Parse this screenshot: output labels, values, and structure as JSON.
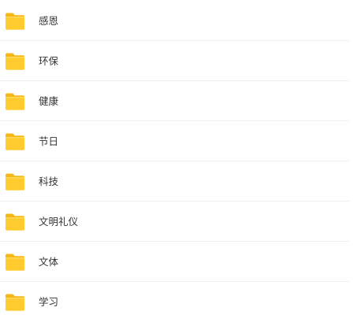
{
  "colors": {
    "folder_tab": "#F6B817",
    "folder_body": "#FFCB2F",
    "folder_highlight": "#FFD95A",
    "text": "#333333",
    "divider": "#F1F1F1"
  },
  "folders": [
    {
      "label": "感恩",
      "icon": "folder-icon"
    },
    {
      "label": "环保",
      "icon": "folder-icon"
    },
    {
      "label": "健康",
      "icon": "folder-icon"
    },
    {
      "label": "节日",
      "icon": "folder-icon"
    },
    {
      "label": "科技",
      "icon": "folder-icon"
    },
    {
      "label": "文明礼仪",
      "icon": "folder-icon"
    },
    {
      "label": "文体",
      "icon": "folder-icon"
    },
    {
      "label": "学习",
      "icon": "folder-icon"
    }
  ]
}
